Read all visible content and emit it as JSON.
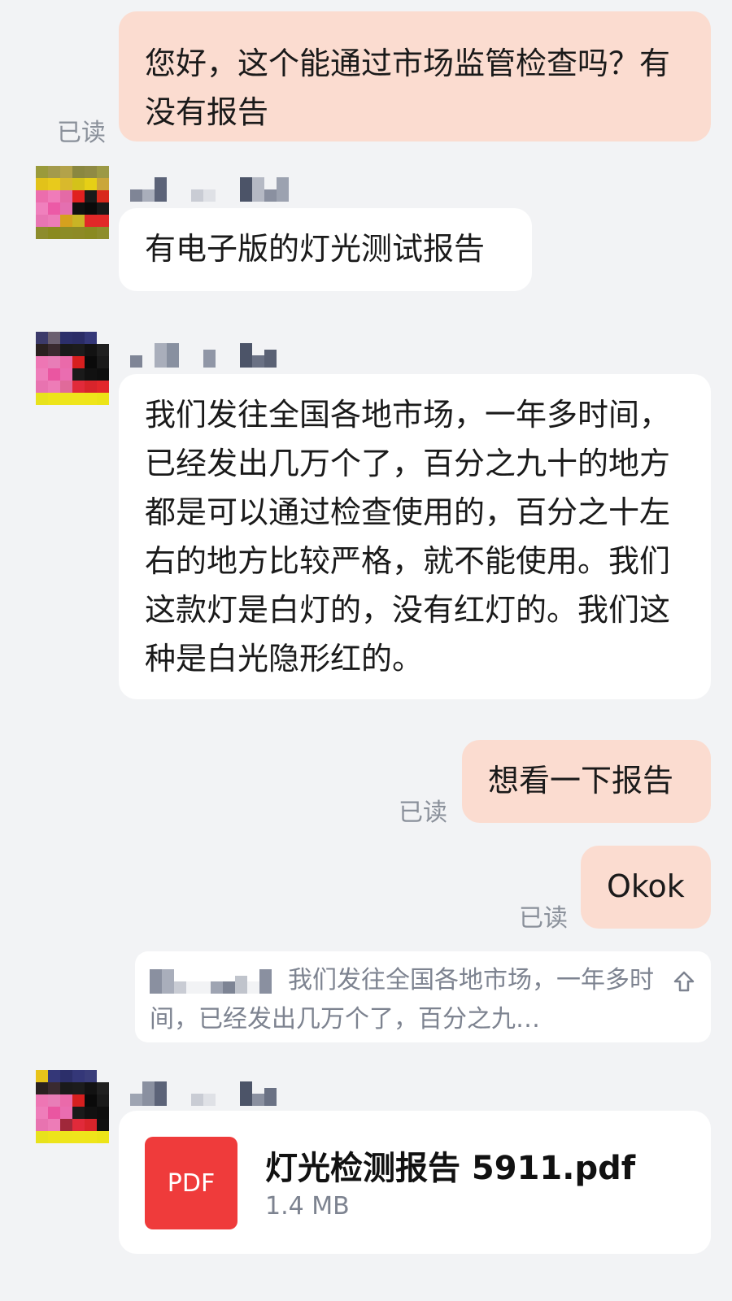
{
  "messages": [
    {
      "text": "您好，这个能通过市场监管检查吗？有没有报告"
    },
    {
      "text": "有电子版的灯光测试报告"
    },
    {
      "text": "我们发往全国各地市场，一年多时间，已经发出几万个了，百分之九十的地方都是可以通过检查使用的，百分之十左右的地方比较严格，就不能使用。我们这款灯是白灯的，没有红灯的。我们这种是白光隐形红的。"
    },
    {
      "text": "想看一下报告"
    },
    {
      "text": "Okok"
    }
  ],
  "read_label": "已读",
  "quote": {
    "text": "我们发往全国各地市场，一年多时间，已经发出几万个了，百分之九…"
  },
  "file": {
    "icon_label": "PDF",
    "name": "灯光检测报告 5911.pdf",
    "size": "1.4 MB",
    "icon": "pdf-file-icon"
  },
  "colors": {
    "background": "#f2f3f5",
    "outgoing_bubble": "#fbdcd0",
    "incoming_bubble": "#ffffff",
    "pdf_red": "#ef3b3b"
  }
}
